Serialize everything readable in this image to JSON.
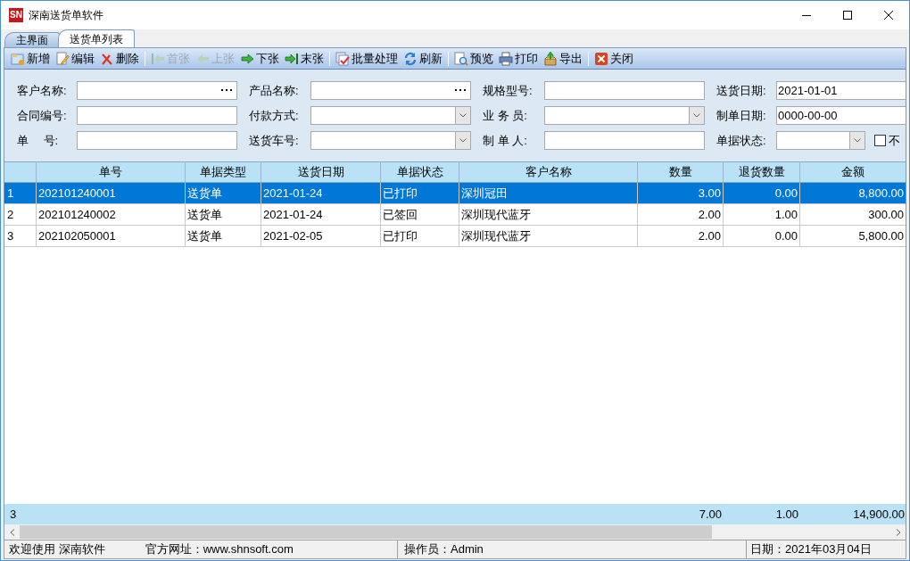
{
  "window": {
    "logo": "SN",
    "title": "深南送货单软件"
  },
  "tabs": [
    {
      "label": "主界面",
      "selected": false
    },
    {
      "label": "送货单列表",
      "selected": true
    }
  ],
  "toolbar": [
    {
      "kind": "button",
      "label": "新增",
      "disabled": false
    },
    {
      "kind": "button",
      "label": "编辑",
      "disabled": false
    },
    {
      "kind": "button",
      "label": "删除",
      "disabled": false
    },
    {
      "kind": "separator"
    },
    {
      "kind": "button",
      "label": "首张",
      "disabled": true
    },
    {
      "kind": "button",
      "label": "上张",
      "disabled": true
    },
    {
      "kind": "button",
      "label": "下张",
      "disabled": false
    },
    {
      "kind": "button",
      "label": "末张",
      "disabled": false
    },
    {
      "kind": "separator"
    },
    {
      "kind": "button",
      "label": "批量处理",
      "disabled": false
    },
    {
      "kind": "button",
      "label": "刷新",
      "disabled": false
    },
    {
      "kind": "separator"
    },
    {
      "kind": "button",
      "label": "预览",
      "disabled": false
    },
    {
      "kind": "button",
      "label": "打印",
      "disabled": false
    },
    {
      "kind": "button",
      "label": "导出",
      "disabled": false
    },
    {
      "kind": "separator"
    },
    {
      "kind": "button",
      "label": "关闭",
      "disabled": false
    }
  ],
  "filters": [
    [
      {
        "label": "客户名称:",
        "kind": "lookup"
      },
      {
        "label": "产品名称:",
        "kind": "lookup"
      },
      {
        "label": "规格型号:",
        "kind": "text"
      },
      {
        "label": "送货日期:",
        "kind": "date",
        "value": "2021-01-01"
      }
    ],
    [
      {
        "label": "合同编号:",
        "kind": "text"
      },
      {
        "label": "付款方式:",
        "kind": "dropdown"
      },
      {
        "label": "业 务 员:",
        "kind": "dropdown"
      },
      {
        "label": "制单日期:",
        "kind": "date",
        "value": "0000-00-00"
      }
    ],
    [
      {
        "label": "单　 号:",
        "kind": "text"
      },
      {
        "label": "送货车号:",
        "kind": "dropdown"
      },
      {
        "label": "制 单 人:",
        "kind": "text"
      },
      {
        "label": "单据状态:",
        "kind": "dropdown"
      },
      {
        "label": "不",
        "kind": "checkbox",
        "checked": false
      }
    ]
  ],
  "table": {
    "columns": [
      {
        "label": "单号",
        "kind": "text"
      },
      {
        "label": "单据类型",
        "kind": "text"
      },
      {
        "label": "送货日期",
        "kind": "text"
      },
      {
        "label": "单据状态",
        "kind": "text"
      },
      {
        "label": "客户名称",
        "kind": "text"
      },
      {
        "label": "数量",
        "kind": "number"
      },
      {
        "label": "退货数量",
        "kind": "number"
      },
      {
        "label": "金额",
        "kind": "number"
      }
    ],
    "rows": [
      {
        "index": "1",
        "selected": true,
        "cells": [
          "202101240001",
          "送货单",
          "2021-01-24",
          "已打印",
          "深圳冠田",
          "3.00",
          "0.00",
          "8,800.00"
        ]
      },
      {
        "index": "2",
        "selected": false,
        "cells": [
          "202101240002",
          "送货单",
          "2021-01-24",
          "已签回",
          "深圳现代蓝牙",
          "2.00",
          "1.00",
          "300.00"
        ]
      },
      {
        "index": "3",
        "selected": false,
        "cells": [
          "202102050001",
          "送货单",
          "2021-02-05",
          "已打印",
          "深圳现代蓝牙",
          "2.00",
          "0.00",
          "5,800.00"
        ]
      }
    ],
    "footer": {
      "count": "3",
      "cells": [
        null,
        null,
        null,
        null,
        null,
        "7.00",
        "1.00",
        "14,900.00"
      ]
    }
  },
  "status_bar": {
    "welcome": "欢迎使用 深南软件",
    "website": "官方网址：www.shnsoft.com",
    "operator": "操作员：Admin",
    "date": "日期：2021年03月04日"
  }
}
